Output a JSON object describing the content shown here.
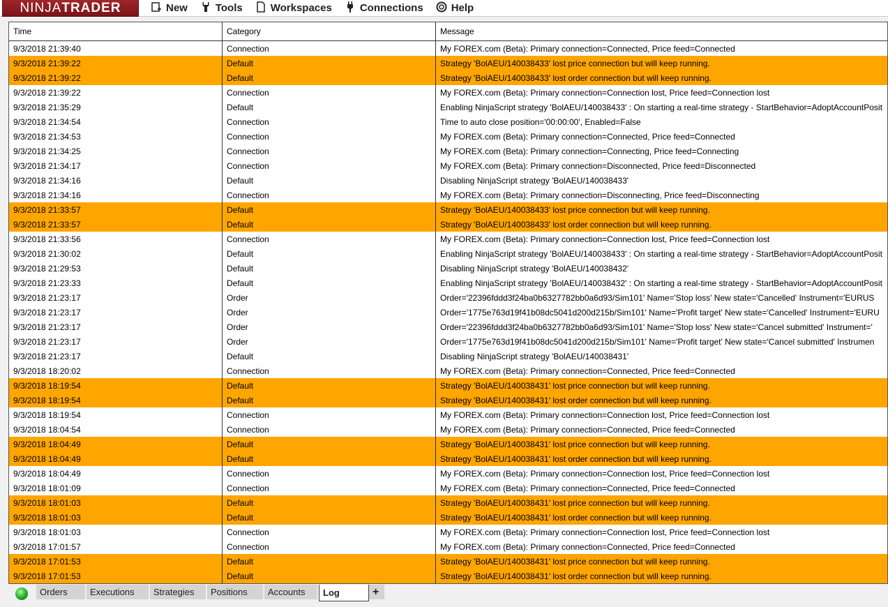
{
  "app": {
    "logo_light": "NINJA",
    "logo_bold": "TRADER"
  },
  "menu": [
    {
      "label": "New",
      "icon": "new-window-icon"
    },
    {
      "label": "Tools",
      "icon": "wrench-icon"
    },
    {
      "label": "Workspaces",
      "icon": "document-icon"
    },
    {
      "label": "Connections",
      "icon": "plug-icon"
    },
    {
      "label": "Help",
      "icon": "lifebuoy-icon"
    }
  ],
  "columns": [
    "Time",
    "Category",
    "Message"
  ],
  "highlight_color": "#FFA500",
  "rows": [
    [
      "9/3/2018 21:39:40",
      "Connection",
      "My FOREX.com (Beta): Primary connection=Connected, Price feed=Connected",
      0
    ],
    [
      "9/3/2018 21:39:22",
      "Default",
      "Strategy 'BolAEU/140038433' lost price connection but will keep running.",
      1
    ],
    [
      "9/3/2018 21:39:22",
      "Default",
      "Strategy 'BolAEU/140038433' lost order connection but will keep running.",
      1
    ],
    [
      "9/3/2018 21:39:22",
      "Connection",
      "My FOREX.com (Beta): Primary connection=Connection lost, Price feed=Connection lost",
      0
    ],
    [
      "9/3/2018 21:35:29",
      "Default",
      "Enabling NinjaScript strategy 'BolAEU/140038433' : On starting a real-time strategy - StartBehavior=AdoptAccountPosit",
      0
    ],
    [
      "9/3/2018 21:34:54",
      "Connection",
      "Time to auto close position='00:00:00', Enabled=False",
      0
    ],
    [
      "9/3/2018 21:34:53",
      "Connection",
      "My FOREX.com (Beta): Primary connection=Connected, Price feed=Connected",
      0
    ],
    [
      "9/3/2018 21:34:25",
      "Connection",
      "My FOREX.com (Beta): Primary connection=Connecting, Price feed=Connecting",
      0
    ],
    [
      "9/3/2018 21:34:17",
      "Connection",
      "My FOREX.com (Beta): Primary connection=Disconnected, Price feed=Disconnected",
      0
    ],
    [
      "9/3/2018 21:34:16",
      "Default",
      "Disabling NinjaScript strategy 'BolAEU/140038433'",
      0
    ],
    [
      "9/3/2018 21:34:16",
      "Connection",
      "My FOREX.com (Beta): Primary connection=Disconnecting, Price feed=Disconnecting",
      0
    ],
    [
      "9/3/2018 21:33:57",
      "Default",
      "Strategy 'BolAEU/140038433' lost price connection but will keep running.",
      1
    ],
    [
      "9/3/2018 21:33:57",
      "Default",
      "Strategy 'BolAEU/140038433' lost order connection but will keep running.",
      1
    ],
    [
      "9/3/2018 21:33:56",
      "Connection",
      "My FOREX.com (Beta): Primary connection=Connection lost, Price feed=Connection lost",
      0
    ],
    [
      "9/3/2018 21:30:02",
      "Default",
      "Enabling NinjaScript strategy 'BolAEU/140038433' : On starting a real-time strategy - StartBehavior=AdoptAccountPosit",
      0
    ],
    [
      "9/3/2018 21:29:53",
      "Default",
      "Disabling NinjaScript strategy 'BolAEU/140038432'",
      0
    ],
    [
      "9/3/2018 21:23:33",
      "Default",
      "Enabling NinjaScript strategy 'BolAEU/140038432' : On starting a real-time strategy - StartBehavior=AdoptAccountPosit",
      0
    ],
    [
      "9/3/2018 21:23:17",
      "Order",
      "Order='22396fddd3f24ba0b6327782bb0a6d93/Sim101' Name='Stop loss' New state='Cancelled' Instrument='EURUS",
      0
    ],
    [
      "9/3/2018 21:23:17",
      "Order",
      "Order='1775e763d19f41b08dc5041d200d215b/Sim101' Name='Profit target' New state='Cancelled' Instrument='EURU",
      0
    ],
    [
      "9/3/2018 21:23:17",
      "Order",
      "Order='22396fddd3f24ba0b6327782bb0a6d93/Sim101' Name='Stop loss' New state='Cancel submitted' Instrument='",
      0
    ],
    [
      "9/3/2018 21:23:17",
      "Order",
      "Order='1775e763d19f41b08dc5041d200d215b/Sim101' Name='Profit target' New state='Cancel submitted' Instrumen",
      0
    ],
    [
      "9/3/2018 21:23:17",
      "Default",
      "Disabling NinjaScript strategy 'BolAEU/140038431'",
      0
    ],
    [
      "9/3/2018 18:20:02",
      "Connection",
      "My FOREX.com (Beta): Primary connection=Connected, Price feed=Connected",
      0
    ],
    [
      "9/3/2018 18:19:54",
      "Default",
      "Strategy 'BolAEU/140038431' lost price connection but will keep running.",
      1
    ],
    [
      "9/3/2018 18:19:54",
      "Default",
      "Strategy 'BolAEU/140038431' lost order connection but will keep running.",
      1
    ],
    [
      "9/3/2018 18:19:54",
      "Connection",
      "My FOREX.com (Beta): Primary connection=Connection lost, Price feed=Connection lost",
      0
    ],
    [
      "9/3/2018 18:04:54",
      "Connection",
      "My FOREX.com (Beta): Primary connection=Connected, Price feed=Connected",
      0
    ],
    [
      "9/3/2018 18:04:49",
      "Default",
      "Strategy 'BolAEU/140038431' lost price connection but will keep running.",
      1
    ],
    [
      "9/3/2018 18:04:49",
      "Default",
      "Strategy 'BolAEU/140038431' lost order connection but will keep running.",
      1
    ],
    [
      "9/3/2018 18:04:49",
      "Connection",
      "My FOREX.com (Beta): Primary connection=Connection lost, Price feed=Connection lost",
      0
    ],
    [
      "9/3/2018 18:01:09",
      "Connection",
      "My FOREX.com (Beta): Primary connection=Connected, Price feed=Connected",
      0
    ],
    [
      "9/3/2018 18:01:03",
      "Default",
      "Strategy 'BolAEU/140038431' lost price connection but will keep running.",
      1
    ],
    [
      "9/3/2018 18:01:03",
      "Default",
      "Strategy 'BolAEU/140038431' lost order connection but will keep running.",
      1
    ],
    [
      "9/3/2018 18:01:03",
      "Connection",
      "My FOREX.com (Beta): Primary connection=Connection lost, Price feed=Connection lost",
      0
    ],
    [
      "9/3/2018 17:01:57",
      "Connection",
      "My FOREX.com (Beta): Primary connection=Connected, Price feed=Connected",
      0
    ],
    [
      "9/3/2018 17:01:53",
      "Default",
      "Strategy 'BolAEU/140038431' lost price connection but will keep running.",
      1
    ],
    [
      "9/3/2018 17:01:53",
      "Default",
      "Strategy 'BolAEU/140038431' lost order connection but will keep running.",
      1
    ]
  ],
  "tabs": [
    {
      "label": "Orders",
      "w": 72
    },
    {
      "label": "Executions",
      "w": 91
    },
    {
      "label": "Strategies",
      "w": 82
    },
    {
      "label": "Positions",
      "w": 82
    },
    {
      "label": "Accounts",
      "w": 78
    },
    {
      "label": "Log",
      "w": 72,
      "active": true
    },
    {
      "label": "+",
      "w": 24
    }
  ],
  "status": {
    "connection": "connected"
  }
}
